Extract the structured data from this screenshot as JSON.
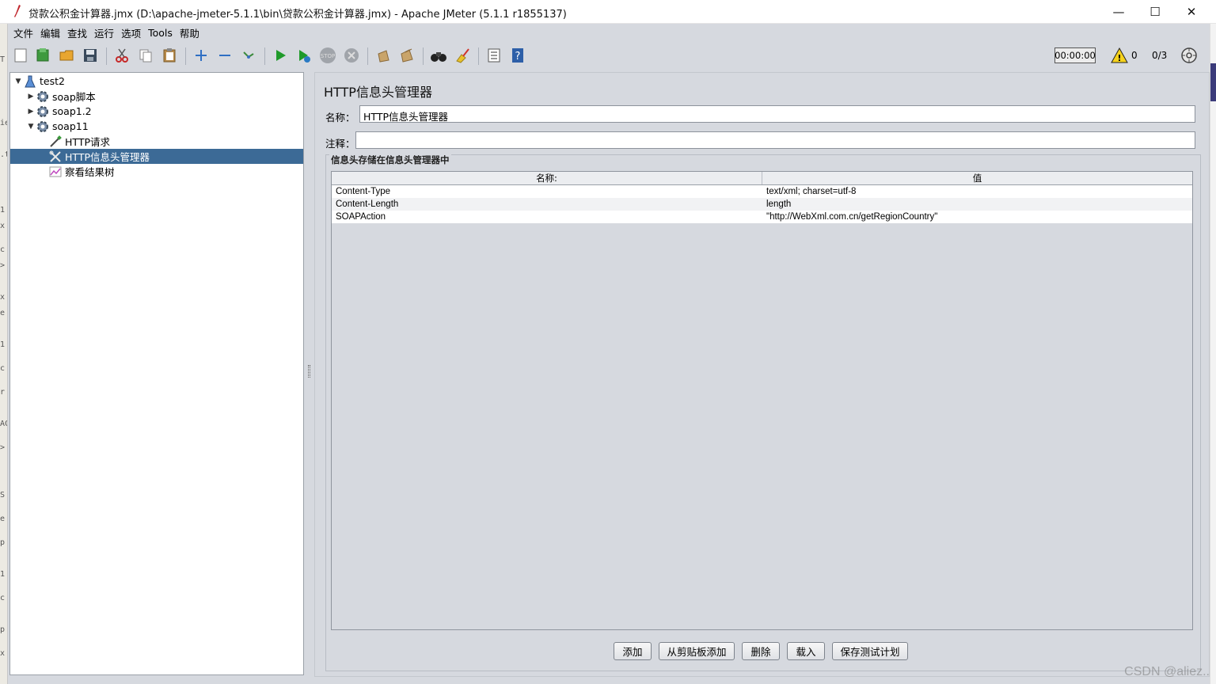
{
  "window": {
    "title": "贷款公积金计算器.jmx (D:\\apache-jmeter-5.1.1\\bin\\贷款公积金计算器.jmx) - Apache JMeter (5.1.1 r1855137)",
    "minimize": "—",
    "maximize": "☐",
    "close": "✕"
  },
  "menu": [
    "文件",
    "编辑",
    "查找",
    "运行",
    "选项",
    "Tools",
    "帮助"
  ],
  "toolbar": {
    "timer": "00:00:00",
    "warnings": "0",
    "threads": "0/3"
  },
  "tree": {
    "items": [
      {
        "label": "test2",
        "icon": "test-plan-icon",
        "toggle": "▼"
      },
      {
        "label": "soap脚本",
        "icon": "thread-group-gear-icon",
        "toggle": "▶"
      },
      {
        "label": "soap1.2",
        "icon": "thread-group-gear-icon",
        "toggle": "▶"
      },
      {
        "label": "soap11",
        "icon": "thread-group-gear-icon",
        "toggle": "▼"
      },
      {
        "label": "HTTP请求",
        "icon": "http-sampler-pipette-icon",
        "toggle": ""
      },
      {
        "label": "HTTP信息头管理器",
        "icon": "config-wrench-icon",
        "toggle": ""
      },
      {
        "label": "察看结果树",
        "icon": "listener-graph-icon",
        "toggle": ""
      }
    ],
    "selected_index": 5
  },
  "panel": {
    "title": "HTTP信息头管理器",
    "name_label": "名称：",
    "name_value": "HTTP信息头管理器",
    "comment_label": "注释：",
    "comment_value": "",
    "group_title": "信息头存储在信息头管理器中",
    "table": {
      "headers": [
        "名称:",
        "值"
      ],
      "rows": [
        [
          "Content-Type",
          "text/xml; charset=utf-8"
        ],
        [
          "Content-Length",
          "length"
        ],
        [
          "SOAPAction",
          "\"http://WebXml.com.cn/getRegionCountry\""
        ]
      ]
    },
    "buttons": {
      "add": "添加",
      "add_from_clipboard": "从剪贴板添加",
      "delete": "删除",
      "load": "载入",
      "save_plan": "保存测试计划"
    }
  },
  "watermark": "CSDN @aliez.."
}
